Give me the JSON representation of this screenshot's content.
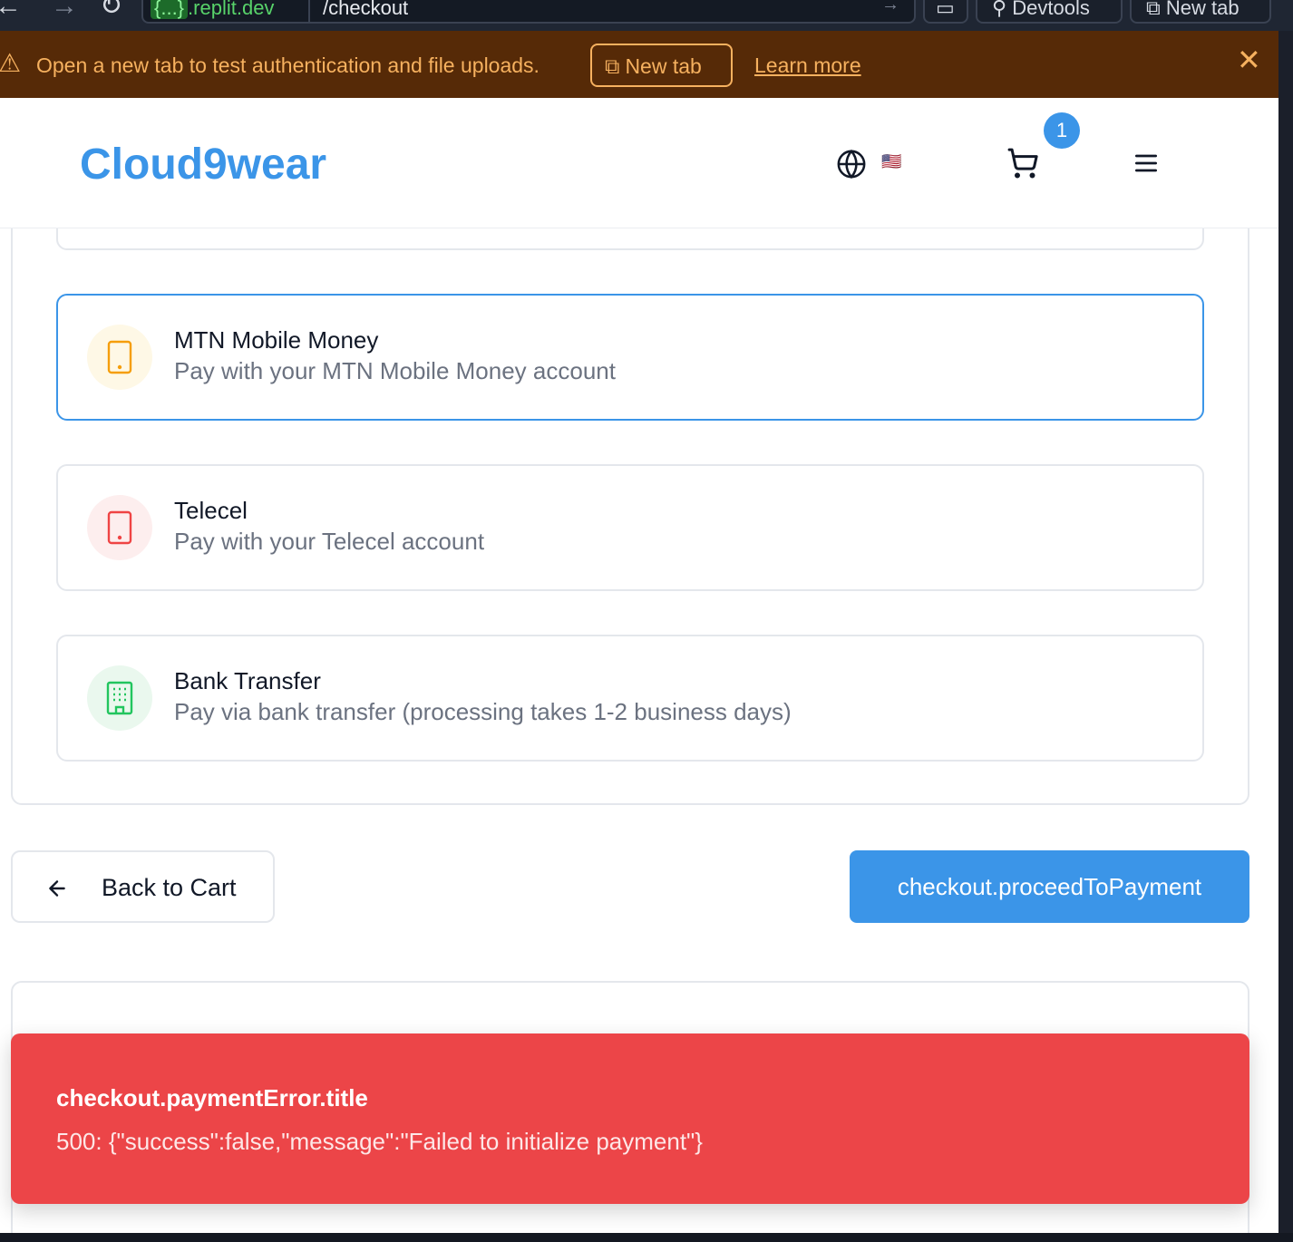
{
  "browser": {
    "url_domain_prefix": "{...}",
    "url_domain": ".replit.dev",
    "url_path": "/checkout",
    "devtools_label": "Devtools",
    "new_tab_label": "New tab"
  },
  "banner": {
    "message": "Open a new tab to test authentication and file uploads.",
    "new_tab_button": "New tab",
    "learn_more": "Learn more"
  },
  "header": {
    "logo": "Cloud9wear",
    "flag": "🇺🇸",
    "cart_count": "1"
  },
  "payment_options": [
    {
      "title": "MTN Mobile Money",
      "description": "Pay with your MTN Mobile Money account",
      "selected": true,
      "icon": "mobile-phone-icon",
      "color": "#f59e0b"
    },
    {
      "title": "Telecel",
      "description": "Pay with your Telecel account",
      "selected": false,
      "icon": "mobile-phone-icon",
      "color": "#ef4444"
    },
    {
      "title": "Bank Transfer",
      "description": "Pay via bank transfer (processing takes 1-2 business days)",
      "selected": false,
      "icon": "building-icon",
      "color": "#22c55e"
    }
  ],
  "actions": {
    "back_label": "Back to Cart",
    "proceed_label": "checkout.proceedToPayment"
  },
  "toast": {
    "title": "checkout.paymentError.title",
    "message": "500: {\"success\":false,\"message\":\"Failed to initialize payment\"}"
  },
  "colors": {
    "accent": "#3b95e8",
    "error": "#ec4548",
    "banner_bg": "#562a07",
    "banner_text": "#f6b15f"
  }
}
